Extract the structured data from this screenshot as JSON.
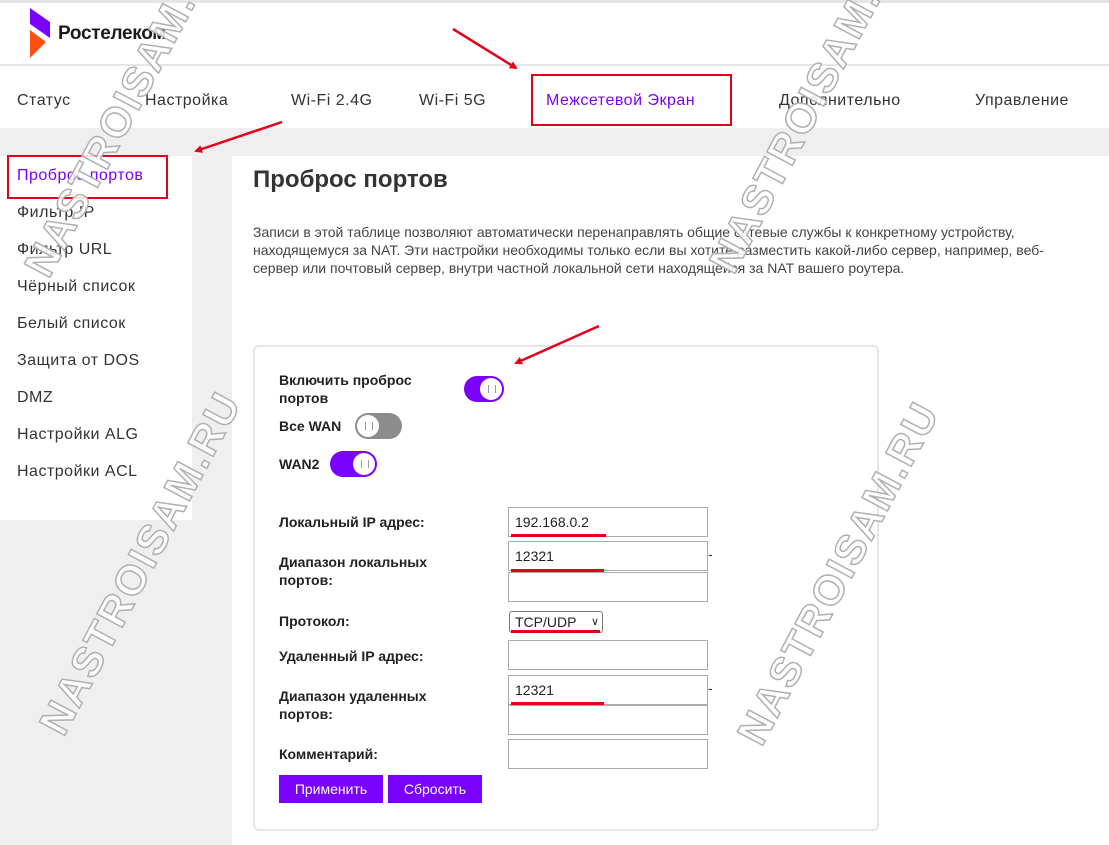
{
  "brand": {
    "name": "Ростелеком"
  },
  "nav": {
    "items": [
      {
        "label": "Статус"
      },
      {
        "label": "Настройка"
      },
      {
        "label": "Wi-Fi 2.4G"
      },
      {
        "label": "Wi-Fi 5G"
      },
      {
        "label": "Межсетевой Экран",
        "active": true
      },
      {
        "label": "Дополнительно"
      },
      {
        "label": "Управление"
      }
    ]
  },
  "sidebar": {
    "items": [
      {
        "label": "Проброс портов",
        "active": true
      },
      {
        "label": "Фильтр IP"
      },
      {
        "label": "Фильтр URL"
      },
      {
        "label": "Чёрный список"
      },
      {
        "label": "Белый список"
      },
      {
        "label": "Защита от DOS"
      },
      {
        "label": "DMZ"
      },
      {
        "label": "Настройки ALG"
      },
      {
        "label": "Настройки ACL"
      }
    ]
  },
  "page": {
    "title": "Проброс портов",
    "description": "Записи в этой таблице позволяют автоматически перенаправлять общие сетевые службы к конкретному устройству, находящемуся за NAT. Эти настройки необходимы только если вы хотите разместить какой-либо сервер, например, веб-сервер или почтовый сервер, внутри частной локальной сети находящейся за NAT вашего роутера."
  },
  "form": {
    "enable_label": "Включить проброс портов",
    "enable_state": "on",
    "all_wan_label": "Все WAN",
    "all_wan_state": "off",
    "wan2_label": "WAN2",
    "wan2_state": "on",
    "local_ip_label": "Локальный IP адрес:",
    "local_ip_value": "192.168.0.2",
    "local_ports_label": "Диапазон локальных портов:",
    "local_port_from": "12321",
    "local_port_to": "",
    "range_dash": "-",
    "protocol_label": "Протокол:",
    "protocol_value": "TCP/UDP",
    "remote_ip_label": "Удаленный IP адрес:",
    "remote_ip_value": "",
    "remote_ports_label": "Диапазон удаленных портов:",
    "remote_port_from": "12321",
    "remote_port_to": "",
    "comment_label": "Комментарий:",
    "comment_value": "",
    "apply_label": "Применить",
    "reset_label": "Сбросить"
  },
  "watermark": {
    "text": "NASTROISAM.RU"
  },
  "colors": {
    "accent": "#7a00ff",
    "highlight": "#e3001b",
    "background": "#efefef"
  },
  "icons": {
    "logo": "rostelecom-logo-icon",
    "chevron": "chevron-down-icon",
    "toggle_grip": "toggle-grip-icon"
  }
}
